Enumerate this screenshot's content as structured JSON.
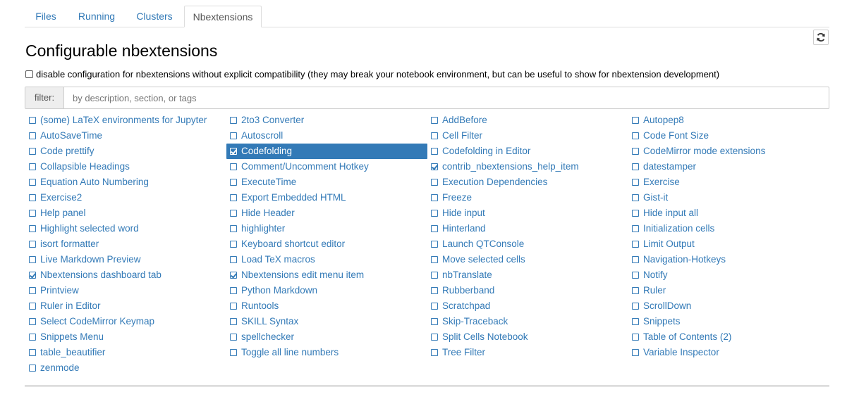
{
  "tabs": [
    {
      "label": "Files",
      "active": false
    },
    {
      "label": "Running",
      "active": false
    },
    {
      "label": "Clusters",
      "active": false
    },
    {
      "label": "Nbextensions",
      "active": true
    }
  ],
  "refresh_icon": "refresh-icon",
  "title": "Configurable nbextensions",
  "disable_config": {
    "checked": false,
    "label": "disable configuration for nbextensions without explicit compatibility (they may break your notebook environment, but can be useful to show for nbextension development)"
  },
  "filter": {
    "label": "filter:",
    "value": "",
    "placeholder": "by description, section, or tags"
  },
  "colors": {
    "link": "#337ab7",
    "selected_bg": "#337ab7",
    "selected_text": "#ffffff"
  },
  "extensions": {
    "columns": [
      [
        {
          "label": "(some) LaTeX environments for Jupyter",
          "checked": false
        },
        {
          "label": "AutoSaveTime",
          "checked": false
        },
        {
          "label": "Code prettify",
          "checked": false
        },
        {
          "label": "Collapsible Headings",
          "checked": false
        },
        {
          "label": "Equation Auto Numbering",
          "checked": false
        },
        {
          "label": "Exercise2",
          "checked": false
        },
        {
          "label": "Help panel",
          "checked": false
        },
        {
          "label": "Highlight selected word",
          "checked": false
        },
        {
          "label": "isort formatter",
          "checked": false
        },
        {
          "label": "Live Markdown Preview",
          "checked": false
        },
        {
          "label": "Nbextensions dashboard tab",
          "checked": true
        },
        {
          "label": "Printview",
          "checked": false
        },
        {
          "label": "Ruler in Editor",
          "checked": false
        },
        {
          "label": "Select CodeMirror Keymap",
          "checked": false
        },
        {
          "label": "Snippets Menu",
          "checked": false
        },
        {
          "label": "table_beautifier",
          "checked": false
        },
        {
          "label": "zenmode",
          "checked": false
        }
      ],
      [
        {
          "label": "2to3 Converter",
          "checked": false
        },
        {
          "label": "Autoscroll",
          "checked": false
        },
        {
          "label": "Codefolding",
          "checked": true,
          "selected": true
        },
        {
          "label": "Comment/Uncomment Hotkey",
          "checked": false
        },
        {
          "label": "ExecuteTime",
          "checked": false
        },
        {
          "label": "Export Embedded HTML",
          "checked": false
        },
        {
          "label": "Hide Header",
          "checked": false
        },
        {
          "label": "highlighter",
          "checked": false
        },
        {
          "label": "Keyboard shortcut editor",
          "checked": false
        },
        {
          "label": "Load TeX macros",
          "checked": false
        },
        {
          "label": "Nbextensions edit menu item",
          "checked": true
        },
        {
          "label": "Python Markdown",
          "checked": false
        },
        {
          "label": "Runtools",
          "checked": false
        },
        {
          "label": "SKILL Syntax",
          "checked": false
        },
        {
          "label": "spellchecker",
          "checked": false
        },
        {
          "label": "Toggle all line numbers",
          "checked": false
        }
      ],
      [
        {
          "label": "AddBefore",
          "checked": false
        },
        {
          "label": "Cell Filter",
          "checked": false
        },
        {
          "label": "Codefolding in Editor",
          "checked": false
        },
        {
          "label": "contrib_nbextensions_help_item",
          "checked": true
        },
        {
          "label": "Execution Dependencies",
          "checked": false
        },
        {
          "label": "Freeze",
          "checked": false
        },
        {
          "label": "Hide input",
          "checked": false
        },
        {
          "label": "Hinterland",
          "checked": false
        },
        {
          "label": "Launch QTConsole",
          "checked": false
        },
        {
          "label": "Move selected cells",
          "checked": false
        },
        {
          "label": "nbTranslate",
          "checked": false
        },
        {
          "label": "Rubberband",
          "checked": false
        },
        {
          "label": "Scratchpad",
          "checked": false
        },
        {
          "label": "Skip-Traceback",
          "checked": false
        },
        {
          "label": "Split Cells Notebook",
          "checked": false
        },
        {
          "label": "Tree Filter",
          "checked": false
        }
      ],
      [
        {
          "label": "Autopep8",
          "checked": false
        },
        {
          "label": "Code Font Size",
          "checked": false
        },
        {
          "label": "CodeMirror mode extensions",
          "checked": false
        },
        {
          "label": "datestamper",
          "checked": false
        },
        {
          "label": "Exercise",
          "checked": false
        },
        {
          "label": "Gist-it",
          "checked": false
        },
        {
          "label": "Hide input all",
          "checked": false
        },
        {
          "label": "Initialization cells",
          "checked": false
        },
        {
          "label": "Limit Output",
          "checked": false
        },
        {
          "label": "Navigation-Hotkeys",
          "checked": false
        },
        {
          "label": "Notify",
          "checked": false
        },
        {
          "label": "Ruler",
          "checked": false
        },
        {
          "label": "ScrollDown",
          "checked": false
        },
        {
          "label": "Snippets",
          "checked": false
        },
        {
          "label": "Table of Contents (2)",
          "checked": false
        },
        {
          "label": "Variable Inspector",
          "checked": false
        }
      ]
    ]
  }
}
